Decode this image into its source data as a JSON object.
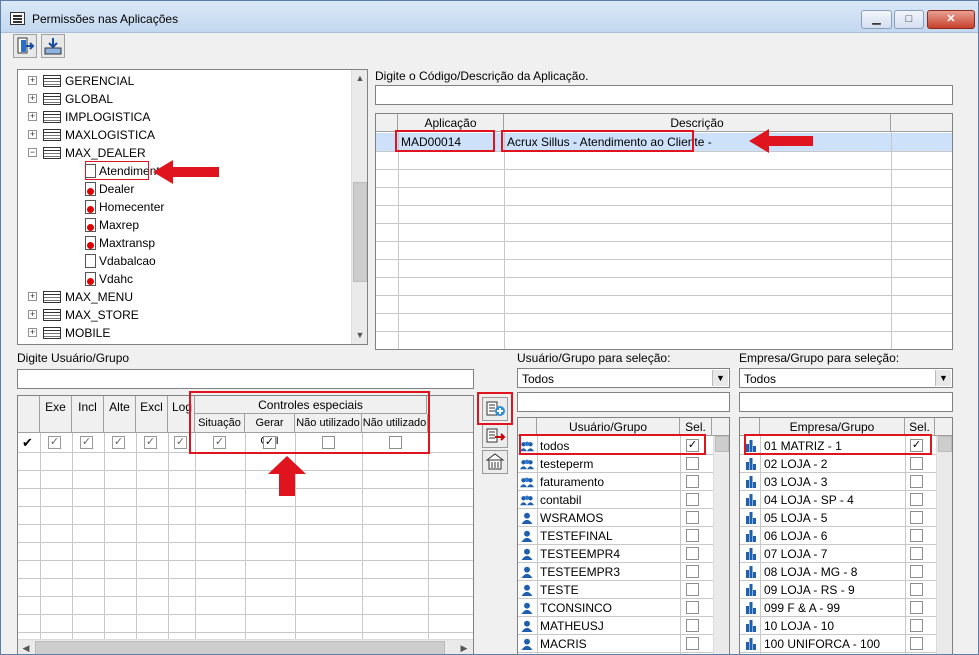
{
  "window": {
    "title": "Permissões nas Aplicações"
  },
  "titlebar": {
    "minimize": "▁",
    "maximize": "□",
    "close": "✕"
  },
  "toolbar": {
    "exit_icon": "exit-door-icon",
    "save_icon": "save-tray-icon"
  },
  "tree": {
    "items": [
      {
        "label": "GERENCIAL",
        "expanded": false
      },
      {
        "label": "GLOBAL",
        "expanded": false
      },
      {
        "label": "IMPLOGISTICA",
        "expanded": false
      },
      {
        "label": "MAXLOGISTICA",
        "expanded": false
      },
      {
        "label": "MAX_DEALER",
        "expanded": true
      },
      {
        "label": "MAX_MENU",
        "expanded": false
      },
      {
        "label": "MAX_STORE",
        "expanded": false
      },
      {
        "label": "MOBILE",
        "expanded": false
      }
    ],
    "children": [
      {
        "label": "Atendimento",
        "icon": "document-icon",
        "selected": true
      },
      {
        "label": "Dealer",
        "icon": "document-red-icon"
      },
      {
        "label": "Homecenter",
        "icon": "document-red-icon"
      },
      {
        "label": "Maxrep",
        "icon": "document-red-icon"
      },
      {
        "label": "Maxtransp",
        "icon": "document-red-icon"
      },
      {
        "label": "Vdabalcao",
        "icon": "document-icon"
      },
      {
        "label": "Vdahc",
        "icon": "document-red-icon"
      }
    ]
  },
  "app_search": {
    "label": "Digite o Código/Descrição da Aplicação.",
    "value": ""
  },
  "app_table": {
    "headers": [
      "Aplicação",
      "Descrição"
    ],
    "rows": [
      {
        "code": "MAD00014",
        "desc": "Acrux Sillus - Atendimento ao Cliente -"
      }
    ]
  },
  "user_search": {
    "label": "Digite Usuário/Grupo",
    "value": ""
  },
  "perm_table": {
    "group_header": "Controles especiais",
    "headers": [
      "Exe",
      "Incl",
      "Alte",
      "Excl",
      "Log"
    ],
    "special_headers": [
      "Situação",
      "Gerar CAI",
      "Não utilizado",
      "Não utilizado"
    ],
    "row_marker": "✔",
    "row": {
      "exe": true,
      "incl": true,
      "alte": true,
      "excl": true,
      "log": true,
      "situacao": true,
      "gerar_cai": true,
      "nao1": false,
      "nao2": false
    }
  },
  "user_select": {
    "label": "Usuário/Grupo para seleção:",
    "dropdown": "Todos",
    "headers": [
      "Usuário/Grupo",
      "Sel."
    ],
    "rows": [
      {
        "name": "todos",
        "type": "group",
        "sel": true
      },
      {
        "name": "testeperm",
        "type": "group",
        "sel": false
      },
      {
        "name": "faturamento",
        "type": "group",
        "sel": false
      },
      {
        "name": "contabil",
        "type": "group",
        "sel": false
      },
      {
        "name": "WSRAMOS",
        "type": "user",
        "sel": false
      },
      {
        "name": "TESTEFINAL",
        "type": "user",
        "sel": false
      },
      {
        "name": "TESTEEMPR4",
        "type": "user",
        "sel": false
      },
      {
        "name": "TESTEEMPR3",
        "type": "user",
        "sel": false
      },
      {
        "name": "TESTE",
        "type": "user",
        "sel": false
      },
      {
        "name": "TCONSINCO",
        "type": "user",
        "sel": false
      },
      {
        "name": "MATHEUSJ",
        "type": "user",
        "sel": false
      },
      {
        "name": "MACRIS",
        "type": "user",
        "sel": false
      }
    ]
  },
  "company_select": {
    "label": "Empresa/Grupo para seleção:",
    "dropdown": "Todos",
    "headers": [
      "Empresa/Grupo",
      "Sel."
    ],
    "rows": [
      {
        "name": "01 MATRIZ - 1",
        "sel": true
      },
      {
        "name": "02 LOJA - 2",
        "sel": false
      },
      {
        "name": "03 LOJA - 3",
        "sel": false
      },
      {
        "name": "04 LOJA - SP - 4",
        "sel": false
      },
      {
        "name": "05 LOJA - 5",
        "sel": false
      },
      {
        "name": "06 LOJA - 6",
        "sel": false
      },
      {
        "name": "07 LOJA - 7",
        "sel": false
      },
      {
        "name": "08 LOJA - MG - 8",
        "sel": false
      },
      {
        "name": "09 LOJA - RS - 9",
        "sel": false
      },
      {
        "name": "099 F & A - 99",
        "sel": false
      },
      {
        "name": "10 LOJA - 10",
        "sel": false
      },
      {
        "name": "100 UNIFORCA - 100",
        "sel": false
      }
    ]
  },
  "colors": {
    "highlight_row": "#cde2fa",
    "annotation": "#e0141e",
    "grid": "#c8c8c8"
  }
}
